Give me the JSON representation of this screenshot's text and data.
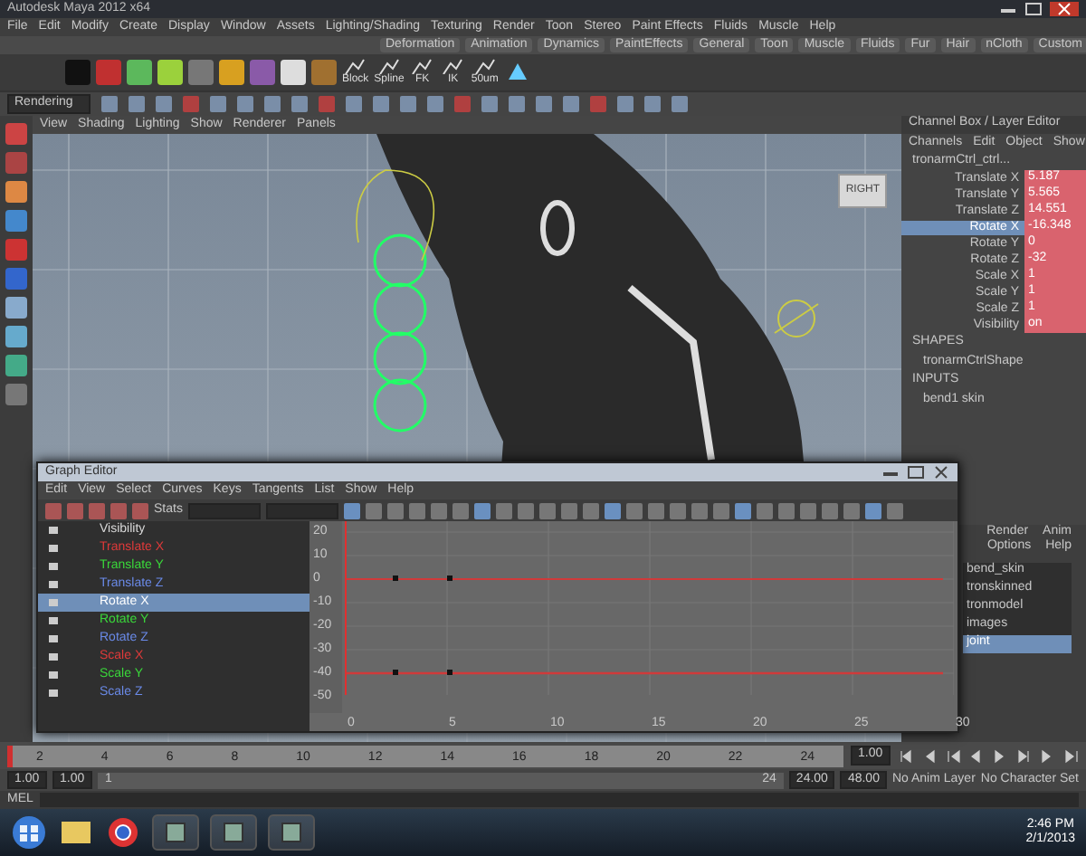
{
  "window": {
    "title": "Autodesk Maya 2012 x64"
  },
  "menu_bar": [
    "File",
    "Edit",
    "Modify",
    "Create",
    "Display",
    "Window",
    "Assets",
    "Lighting/Shading",
    "Texturing",
    "Render",
    "Toon",
    "Stereo",
    "Paint Effects",
    "Fluids",
    "Muscle",
    "Help"
  ],
  "shelf_tabs": [
    "Deformation",
    "Animation",
    "Dynamics",
    "PaintEffects",
    "General",
    "Toon",
    "Muscle",
    "Fluids",
    "Fur",
    "Hair",
    "nCloth",
    "Custom"
  ],
  "shelf_buttons": [
    {
      "label": "Block"
    },
    {
      "label": "Spline"
    },
    {
      "label": "FK"
    },
    {
      "label": "IK"
    },
    {
      "label": "50um"
    }
  ],
  "status_line": {
    "mode": "Rendering"
  },
  "viewport": {
    "menu": [
      "View",
      "Shading",
      "Lighting",
      "Show",
      "Renderer",
      "Panels"
    ],
    "view_cube": "RIGHT"
  },
  "channel_box": {
    "title": "Channel Box / Layer Editor",
    "menu": [
      "Channels",
      "Edit",
      "Object",
      "Show"
    ],
    "object": "tronarmCtrl_ctrl...",
    "attributes": [
      {
        "name": "Translate X",
        "value": "5.187",
        "selected": false
      },
      {
        "name": "Translate Y",
        "value": "5.565",
        "selected": false
      },
      {
        "name": "Translate Z",
        "value": "14.551",
        "selected": false
      },
      {
        "name": "Rotate X",
        "value": "-16.348",
        "selected": true
      },
      {
        "name": "Rotate Y",
        "value": "0",
        "selected": false
      },
      {
        "name": "Rotate Z",
        "value": "-32",
        "selected": false
      },
      {
        "name": "Scale X",
        "value": "1",
        "selected": false
      },
      {
        "name": "Scale Y",
        "value": "1",
        "selected": false
      },
      {
        "name": "Scale Z",
        "value": "1",
        "selected": false
      },
      {
        "name": "Visibility",
        "value": "on",
        "selected": false
      }
    ],
    "shapes_label": "SHAPES",
    "shape": "tronarmCtrlShape",
    "inputs_label": "INPUTS",
    "input": "bend1 skin"
  },
  "layer_editor": {
    "tabs": [
      "Render",
      "Anim"
    ],
    "menu": [
      "Options",
      "Help"
    ],
    "layers": [
      {
        "name": "bend_skin",
        "selected": false
      },
      {
        "name": "tronskinned",
        "selected": false
      },
      {
        "name": "tronmodel",
        "selected": false
      },
      {
        "name": "images",
        "selected": false
      },
      {
        "name": "joint",
        "selected": true
      }
    ]
  },
  "graph_editor": {
    "title": "Graph Editor",
    "menu": [
      "Edit",
      "View",
      "Select",
      "Curves",
      "Keys",
      "Tangents",
      "List",
      "Show",
      "Help"
    ],
    "stats_label": "Stats",
    "outliner": [
      {
        "name": "Visibility",
        "color": "#d8d8d8",
        "selected": false
      },
      {
        "name": "Translate X",
        "color": "#e03a3a",
        "selected": false
      },
      {
        "name": "Translate Y",
        "color": "#3ad83a",
        "selected": false
      },
      {
        "name": "Translate Z",
        "color": "#6a8ae8",
        "selected": false
      },
      {
        "name": "Rotate X",
        "selected": true
      },
      {
        "name": "Rotate Y",
        "color": "#3ad83a",
        "selected": false
      },
      {
        "name": "Rotate Z",
        "color": "#6a8ae8",
        "selected": false
      },
      {
        "name": "Scale X",
        "color": "#e03a3a",
        "selected": false
      },
      {
        "name": "Scale Y",
        "color": "#3ad83a",
        "selected": false
      },
      {
        "name": "Scale Z",
        "color": "#6a8ae8",
        "selected": false
      }
    ],
    "y_labels": [
      "20",
      "10",
      "0",
      "-10",
      "-20",
      "-30",
      "-40",
      "-50"
    ],
    "x_labels": [
      "0",
      "5",
      "10",
      "15",
      "20",
      "25",
      "30"
    ]
  },
  "time_slider": {
    "level": 0,
    "ticks": [
      "2",
      "4",
      "6",
      "8",
      "10",
      "12",
      "14",
      "16",
      "18",
      "20",
      "22",
      "24"
    ],
    "current_frame": "1.00"
  },
  "range_slider": {
    "level": 1,
    "start": "1.00",
    "playback_start": "1.00",
    "range_start": "1",
    "range_end": "24",
    "playback_end": "24.00",
    "end": "48.00",
    "anim_layer": "No Anim Layer",
    "character_set": "No Character Set"
  },
  "command_line": {
    "label": "MEL"
  },
  "taskbar": {
    "time": "2:46 PM",
    "date": "2/1/2013"
  }
}
